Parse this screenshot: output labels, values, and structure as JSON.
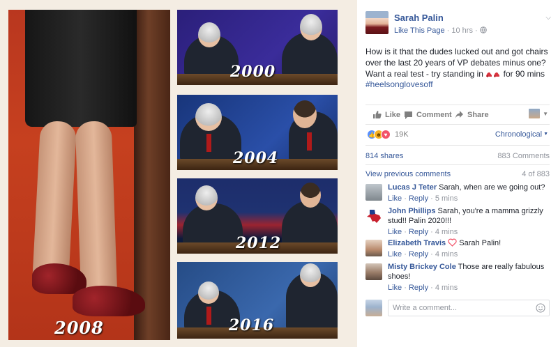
{
  "collage": {
    "years": {
      "main": "2008",
      "p1": "2000",
      "p2": "2004",
      "p3": "2012",
      "p4": "2016"
    }
  },
  "post": {
    "author": "Sarah Palin",
    "like_page": "Like This Page",
    "separator": "·",
    "time": "10 hrs",
    "audience": "·",
    "text_before_emoji": "How is it that the dudes lucked out and got chairs over the last 20 years of VP debates minus one? Want a real test - try standing in",
    "emoji": "high-heel-shoes",
    "text_after_emoji": " for 90 mins",
    "hashtag": "#heelsonglovesoff"
  },
  "actions": {
    "like": "Like",
    "comment": "Comment",
    "share": "Share"
  },
  "reactions": {
    "icons": [
      "like-reaction",
      "haha-reaction",
      "love-reaction"
    ],
    "count": "19K",
    "sort": "Chronological"
  },
  "stats": {
    "shares": "814 shares",
    "comments": "883 Comments"
  },
  "comments_header": {
    "view_previous": "View previous comments",
    "count": "4 of 883"
  },
  "comments": [
    {
      "author": "Lucas J Teter",
      "text": " Sarah, when are we going out?",
      "like": "Like",
      "reply": "Reply",
      "time": "5 mins"
    },
    {
      "author": "John Phillips",
      "text": " Sarah, you're a mamma grizzly stud!! Palin 2020!!!",
      "like": "Like",
      "reply": "Reply",
      "time": "4 mins"
    },
    {
      "author": "Elizabeth Travis",
      "text": " Sarah Palin!",
      "like": "Like",
      "reply": "Reply",
      "time": "4 mins"
    },
    {
      "author": "Misty Brickey Cole",
      "text": " Those are really fabulous shoes!",
      "like": "Like",
      "reply": "Reply",
      "time": "4 mins"
    }
  ],
  "composer": {
    "placeholder": "Write a comment..."
  },
  "colors": {
    "link": "#365899",
    "text": "#1d2129",
    "muted": "#90949c",
    "like_blue": "#5890ff",
    "love_red": "#f25268",
    "haha_yellow": "#f7b125"
  }
}
